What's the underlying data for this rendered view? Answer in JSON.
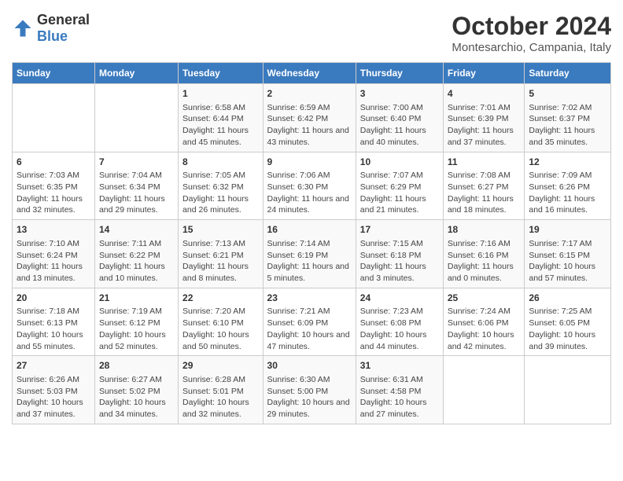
{
  "logo": {
    "general": "General",
    "blue": "Blue"
  },
  "title": "October 2024",
  "location": "Montesarchio, Campania, Italy",
  "weekdays": [
    "Sunday",
    "Monday",
    "Tuesday",
    "Wednesday",
    "Thursday",
    "Friday",
    "Saturday"
  ],
  "weeks": [
    [
      {
        "day": "",
        "content": ""
      },
      {
        "day": "",
        "content": ""
      },
      {
        "day": "1",
        "content": "Sunrise: 6:58 AM\nSunset: 6:44 PM\nDaylight: 11 hours and 45 minutes."
      },
      {
        "day": "2",
        "content": "Sunrise: 6:59 AM\nSunset: 6:42 PM\nDaylight: 11 hours and 43 minutes."
      },
      {
        "day": "3",
        "content": "Sunrise: 7:00 AM\nSunset: 6:40 PM\nDaylight: 11 hours and 40 minutes."
      },
      {
        "day": "4",
        "content": "Sunrise: 7:01 AM\nSunset: 6:39 PM\nDaylight: 11 hours and 37 minutes."
      },
      {
        "day": "5",
        "content": "Sunrise: 7:02 AM\nSunset: 6:37 PM\nDaylight: 11 hours and 35 minutes."
      }
    ],
    [
      {
        "day": "6",
        "content": "Sunrise: 7:03 AM\nSunset: 6:35 PM\nDaylight: 11 hours and 32 minutes."
      },
      {
        "day": "7",
        "content": "Sunrise: 7:04 AM\nSunset: 6:34 PM\nDaylight: 11 hours and 29 minutes."
      },
      {
        "day": "8",
        "content": "Sunrise: 7:05 AM\nSunset: 6:32 PM\nDaylight: 11 hours and 26 minutes."
      },
      {
        "day": "9",
        "content": "Sunrise: 7:06 AM\nSunset: 6:30 PM\nDaylight: 11 hours and 24 minutes."
      },
      {
        "day": "10",
        "content": "Sunrise: 7:07 AM\nSunset: 6:29 PM\nDaylight: 11 hours and 21 minutes."
      },
      {
        "day": "11",
        "content": "Sunrise: 7:08 AM\nSunset: 6:27 PM\nDaylight: 11 hours and 18 minutes."
      },
      {
        "day": "12",
        "content": "Sunrise: 7:09 AM\nSunset: 6:26 PM\nDaylight: 11 hours and 16 minutes."
      }
    ],
    [
      {
        "day": "13",
        "content": "Sunrise: 7:10 AM\nSunset: 6:24 PM\nDaylight: 11 hours and 13 minutes."
      },
      {
        "day": "14",
        "content": "Sunrise: 7:11 AM\nSunset: 6:22 PM\nDaylight: 11 hours and 10 minutes."
      },
      {
        "day": "15",
        "content": "Sunrise: 7:13 AM\nSunset: 6:21 PM\nDaylight: 11 hours and 8 minutes."
      },
      {
        "day": "16",
        "content": "Sunrise: 7:14 AM\nSunset: 6:19 PM\nDaylight: 11 hours and 5 minutes."
      },
      {
        "day": "17",
        "content": "Sunrise: 7:15 AM\nSunset: 6:18 PM\nDaylight: 11 hours and 3 minutes."
      },
      {
        "day": "18",
        "content": "Sunrise: 7:16 AM\nSunset: 6:16 PM\nDaylight: 11 hours and 0 minutes."
      },
      {
        "day": "19",
        "content": "Sunrise: 7:17 AM\nSunset: 6:15 PM\nDaylight: 10 hours and 57 minutes."
      }
    ],
    [
      {
        "day": "20",
        "content": "Sunrise: 7:18 AM\nSunset: 6:13 PM\nDaylight: 10 hours and 55 minutes."
      },
      {
        "day": "21",
        "content": "Sunrise: 7:19 AM\nSunset: 6:12 PM\nDaylight: 10 hours and 52 minutes."
      },
      {
        "day": "22",
        "content": "Sunrise: 7:20 AM\nSunset: 6:10 PM\nDaylight: 10 hours and 50 minutes."
      },
      {
        "day": "23",
        "content": "Sunrise: 7:21 AM\nSunset: 6:09 PM\nDaylight: 10 hours and 47 minutes."
      },
      {
        "day": "24",
        "content": "Sunrise: 7:23 AM\nSunset: 6:08 PM\nDaylight: 10 hours and 44 minutes."
      },
      {
        "day": "25",
        "content": "Sunrise: 7:24 AM\nSunset: 6:06 PM\nDaylight: 10 hours and 42 minutes."
      },
      {
        "day": "26",
        "content": "Sunrise: 7:25 AM\nSunset: 6:05 PM\nDaylight: 10 hours and 39 minutes."
      }
    ],
    [
      {
        "day": "27",
        "content": "Sunrise: 6:26 AM\nSunset: 5:03 PM\nDaylight: 10 hours and 37 minutes."
      },
      {
        "day": "28",
        "content": "Sunrise: 6:27 AM\nSunset: 5:02 PM\nDaylight: 10 hours and 34 minutes."
      },
      {
        "day": "29",
        "content": "Sunrise: 6:28 AM\nSunset: 5:01 PM\nDaylight: 10 hours and 32 minutes."
      },
      {
        "day": "30",
        "content": "Sunrise: 6:30 AM\nSunset: 5:00 PM\nDaylight: 10 hours and 29 minutes."
      },
      {
        "day": "31",
        "content": "Sunrise: 6:31 AM\nSunset: 4:58 PM\nDaylight: 10 hours and 27 minutes."
      },
      {
        "day": "",
        "content": ""
      },
      {
        "day": "",
        "content": ""
      }
    ]
  ]
}
